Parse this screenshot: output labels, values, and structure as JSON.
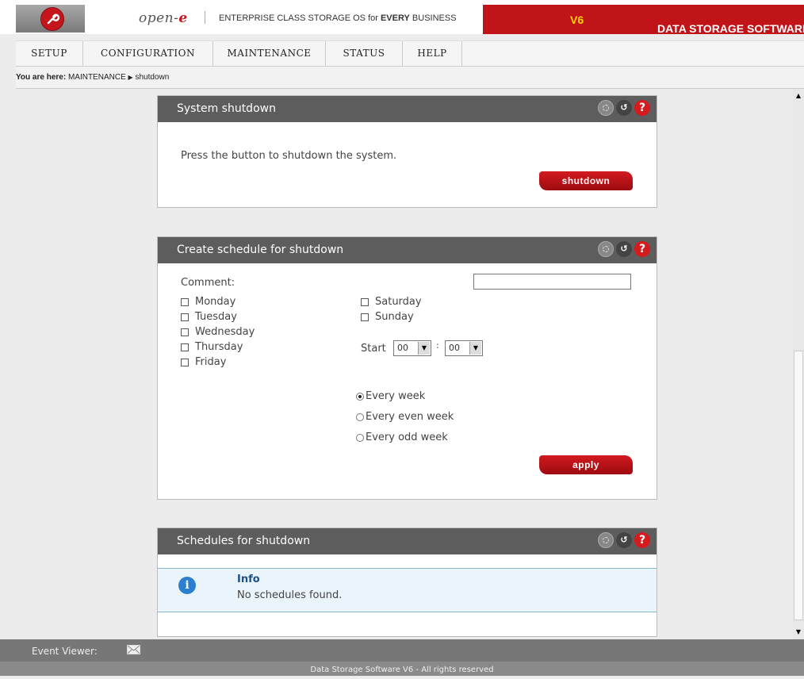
{
  "header": {
    "brand_prefix": "open-",
    "brand_suffix": "e",
    "tagline_pre": "ENTERPRISE CLASS STORAGE OS for ",
    "tagline_bold": "EVERY",
    "tagline_post": " BUSINESS",
    "product_title": "DATA STORAGE SOFTWARE ",
    "product_version": "V6",
    "logo_icon": "wrench-icon"
  },
  "menu": {
    "items": [
      {
        "label": "SETUP"
      },
      {
        "label": "CONFIGURATION"
      },
      {
        "label": "MAINTENANCE"
      },
      {
        "label": "STATUS"
      },
      {
        "label": "HELP"
      }
    ]
  },
  "breadcrumb": {
    "prefix": "You are here:",
    "section": "MAINTENANCE",
    "page": "shutdown"
  },
  "panels": {
    "shutdown": {
      "title": "System shutdown",
      "text": "Press the button to shutdown the system.",
      "button": "shutdown"
    },
    "schedule": {
      "title": "Create schedule for shutdown",
      "comment_label": "Comment:",
      "comment_value": "",
      "days_left": [
        "Monday",
        "Tuesday",
        "Wednesday",
        "Thursday",
        "Friday"
      ],
      "days_right": [
        "Saturday",
        "Sunday"
      ],
      "start_label": "Start",
      "hour": "00",
      "minute": "00",
      "time_sep": ":",
      "recurrence": [
        "Every week",
        "Every even week",
        "Every odd week"
      ],
      "recurrence_selected": "Every week",
      "button": "apply"
    },
    "list": {
      "title": "Schedules for shutdown",
      "info_title": "Info",
      "info_text": "No schedules found."
    }
  },
  "footer": {
    "event_viewer": "Event Viewer:",
    "copyright": "Data Storage Software V6 - All rights reserved"
  },
  "colors": {
    "accent": "#c01418",
    "panel_header": "#5d5d5d",
    "info_bg": "#eaf4fb"
  }
}
